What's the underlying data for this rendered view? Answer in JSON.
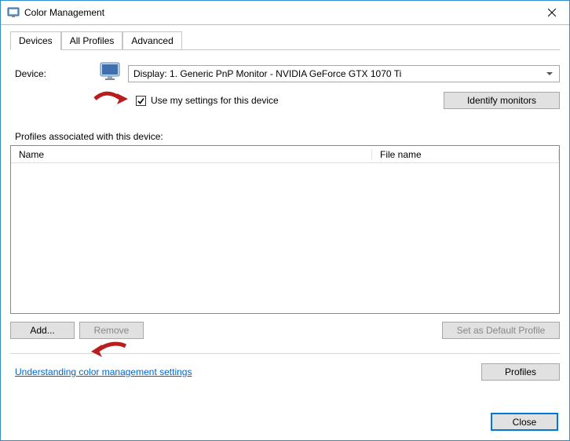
{
  "window": {
    "title": "Color Management"
  },
  "tabs": {
    "devices": "Devices",
    "allProfiles": "All Profiles",
    "advanced": "Advanced"
  },
  "device": {
    "label": "Device:",
    "selected": "Display: 1. Generic PnP Monitor - NVIDIA GeForce GTX 1070 Ti",
    "useMySettings": "Use my settings for this device",
    "identify": "Identify monitors"
  },
  "profiles": {
    "heading": "Profiles associated with this device:",
    "colName": "Name",
    "colFile": "File name"
  },
  "buttons": {
    "add": "Add...",
    "remove": "Remove",
    "setDefault": "Set as Default Profile",
    "profiles": "Profiles",
    "close": "Close"
  },
  "link": {
    "understanding": "Understanding color management settings"
  }
}
